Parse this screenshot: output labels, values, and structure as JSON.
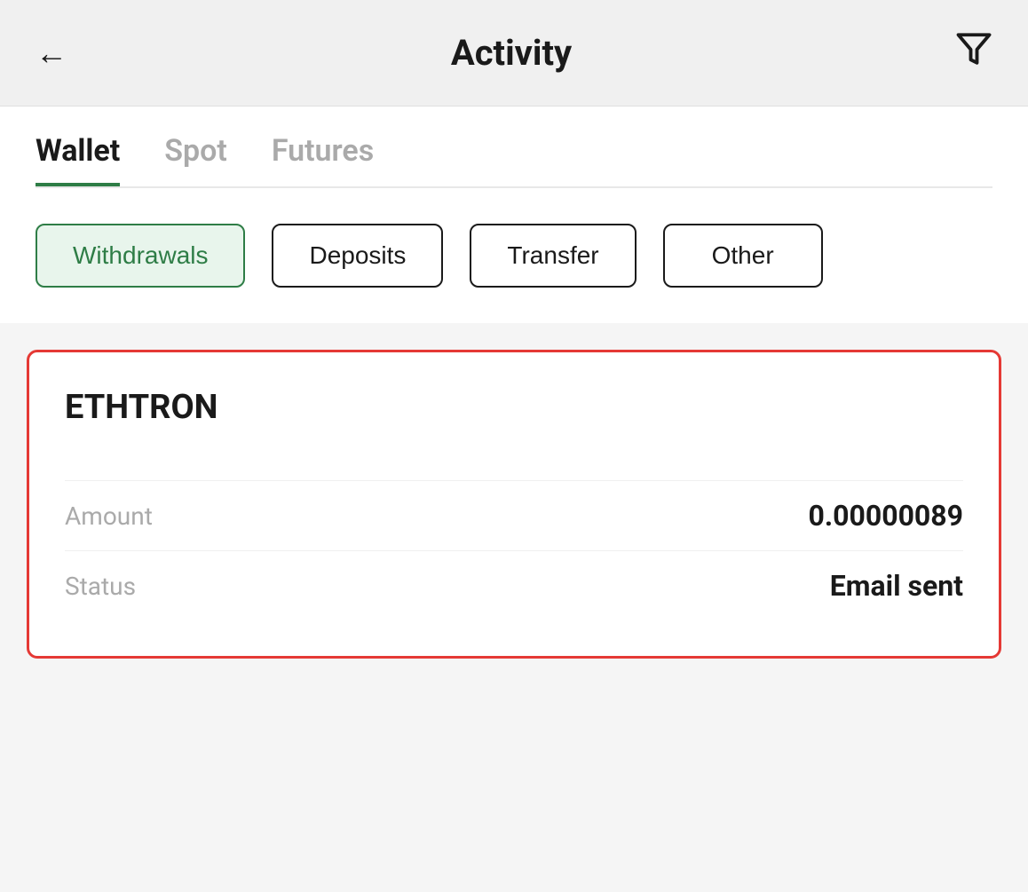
{
  "header": {
    "title": "Activity",
    "back_label": "←",
    "filter_label": "filter"
  },
  "tabs": {
    "items": [
      {
        "id": "wallet",
        "label": "Wallet",
        "active": true
      },
      {
        "id": "spot",
        "label": "Spot",
        "active": false
      },
      {
        "id": "futures",
        "label": "Futures",
        "active": false
      }
    ]
  },
  "filter_buttons": [
    {
      "id": "withdrawals",
      "label": "Withdrawals",
      "active": true
    },
    {
      "id": "deposits",
      "label": "Deposits",
      "active": false
    },
    {
      "id": "transfer",
      "label": "Transfer",
      "active": false
    },
    {
      "id": "other",
      "label": "Other",
      "active": false
    }
  ],
  "transaction": {
    "name": "ETHTRON",
    "amount_label": "Amount",
    "amount_value": "0.00000089",
    "status_label": "Status",
    "status_value": "Email sent"
  },
  "colors": {
    "active_tab_underline": "#2e7d46",
    "active_filter_bg": "#e8f5ec",
    "active_filter_border": "#2e7d46",
    "active_filter_text": "#2e7d46",
    "card_border": "#e53935"
  }
}
